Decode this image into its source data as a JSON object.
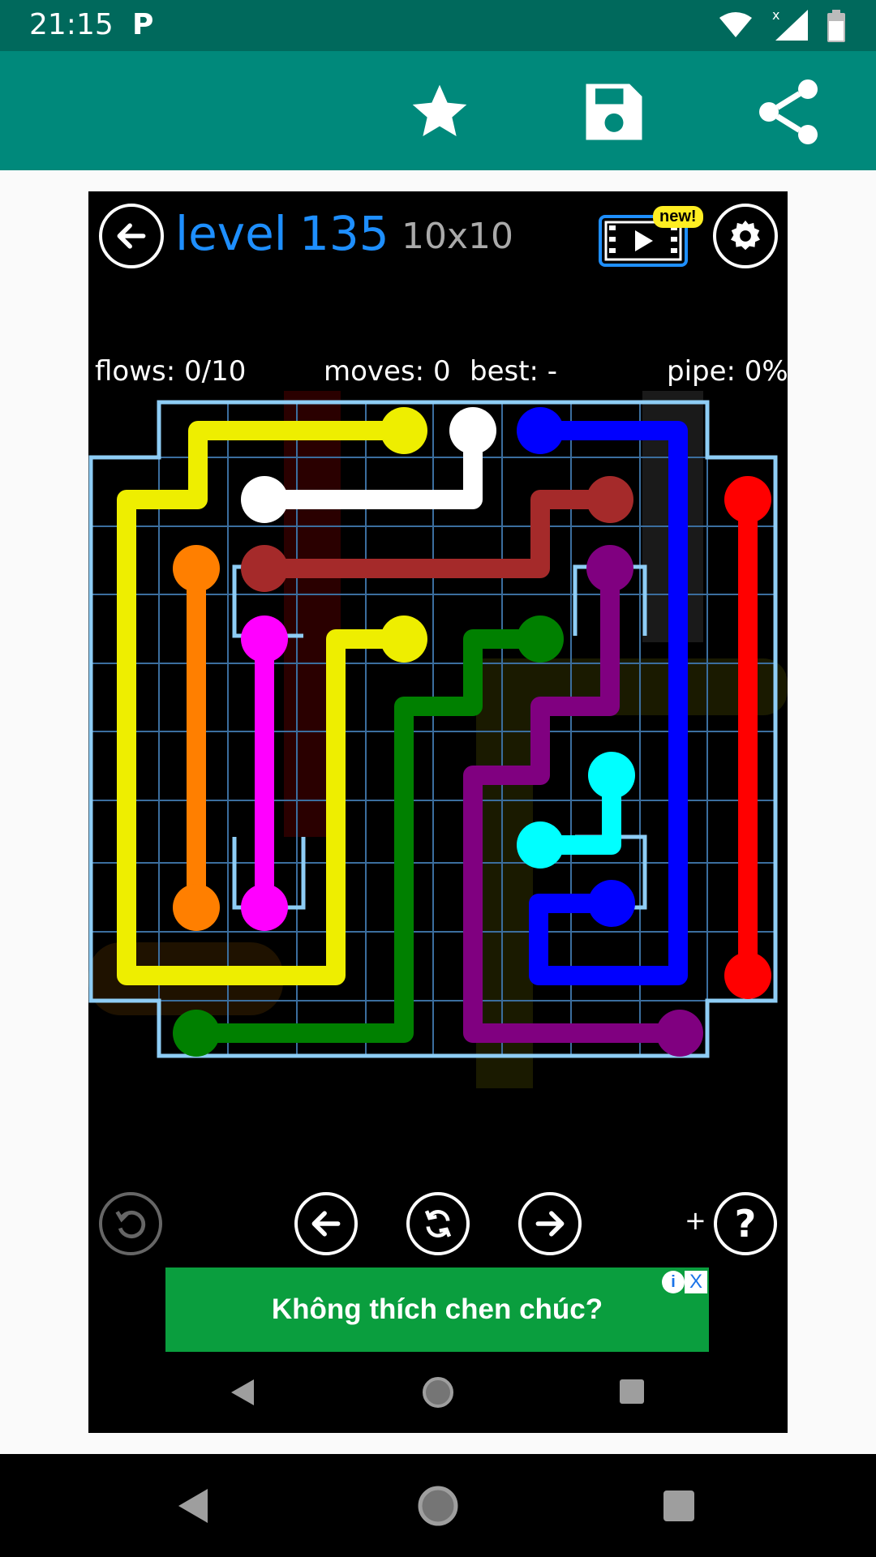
{
  "status_bar": {
    "time": "21:15",
    "app_badge": "P",
    "icons": [
      "wifi-icon",
      "signal-icon",
      "battery-icon"
    ]
  },
  "app_bar": {
    "actions": [
      "star-icon",
      "save-icon",
      "share-icon"
    ]
  },
  "game": {
    "level_label": "level",
    "level_number": "135",
    "grid_size": "10x10",
    "new_badge": "new!",
    "stats": {
      "flows": "flows: 0/10",
      "moves": "moves: 0",
      "best": "best: -",
      "pipe": "pipe: 0%"
    },
    "hint_plus": "+",
    "hint_label": "?",
    "colors": {
      "yellow": "#eeee00",
      "white": "#ffffff",
      "blue": "#0000ff",
      "red": "#ff0000",
      "brown": "#a52a2a",
      "orange": "#ff7f00",
      "purple": "#800080",
      "magenta": "#ff00ff",
      "green": "#008000",
      "cyan": "#00ffff",
      "board_border": "#8ecdf5",
      "grid": "#3b6e9e"
    }
  },
  "ad": {
    "text": "Không thích chen chúc?",
    "info": "i",
    "close": "X"
  },
  "system_nav": [
    "back-icon",
    "home-icon",
    "recents-icon"
  ]
}
